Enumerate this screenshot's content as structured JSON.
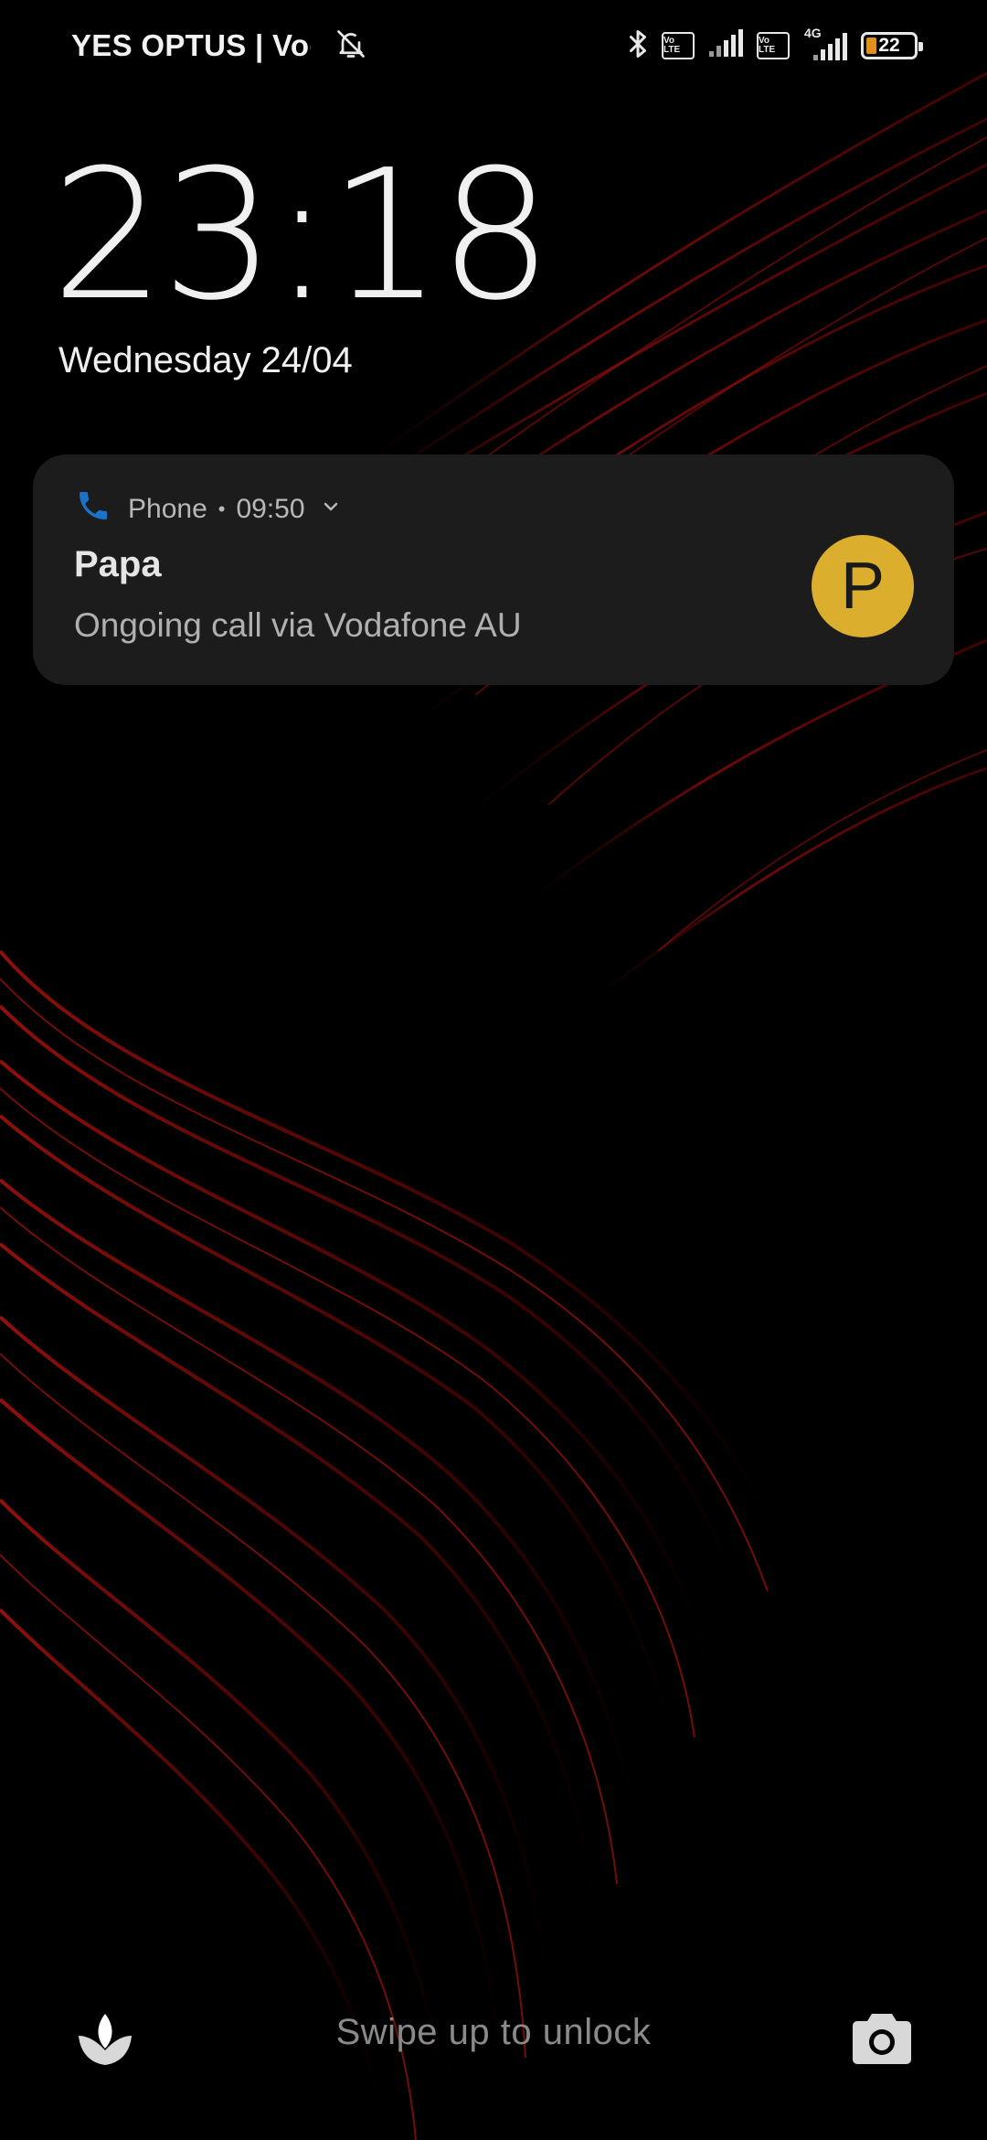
{
  "status_bar": {
    "carrier": "YES OPTUS | Vodafone AU",
    "volte_1": "Vo LTE",
    "volte_2": "Vo LTE",
    "network_type": "4G",
    "battery_level": "22",
    "battery_fraction": 0.22,
    "icons": [
      "bell-off-icon",
      "bluetooth-icon",
      "volte-icon",
      "signal-icon",
      "volte-icon",
      "signal-4g-icon",
      "battery-icon"
    ]
  },
  "lockscreen": {
    "time": "23:18",
    "date": "Wednesday 24/04"
  },
  "notification": {
    "app_name": "Phone",
    "separator": "•",
    "time": "09:50",
    "title": "Papa",
    "body": "Ongoing call via Vodafone AU",
    "avatar_letter": "P",
    "avatar_color": "#dcae2d",
    "app_icon": "phone-icon",
    "accent_color": "#1a73c8"
  },
  "bottom": {
    "swipe_text": "Swipe up to unlock",
    "left_shortcut_icon": "leaf-assistant-icon",
    "right_shortcut_icon": "camera-icon"
  }
}
